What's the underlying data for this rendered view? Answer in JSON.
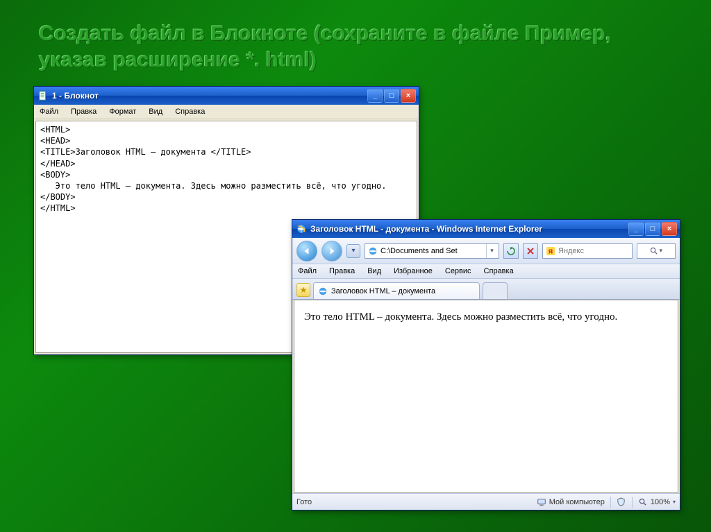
{
  "slide": {
    "title": "Создать файл в Блокноте (сохраните в файле Пример,  указав расширение  *. html)"
  },
  "notepad": {
    "title": "1 - Блокнот",
    "menu": {
      "file": "Файл",
      "edit": "Правка",
      "format": "Формат",
      "view": "Вид",
      "help": "Справка"
    },
    "code": "<HTML>\n<HEAD>\n<TITLE>Заголовок HTML – документа </TITLE>\n</HEAD>\n<BODY>\n   Это тело HTML – документа. Здесь можно разместить всё, что угодно.\n</BODY>\n</HTML>"
  },
  "ie": {
    "title": "Заголовок HTML - документа - Windows Internet Explorer",
    "address": "C:\\Documents and Set",
    "search_placeholder": "Яндекс",
    "menu": {
      "file": "Файл",
      "edit": "Правка",
      "view": "Вид",
      "favorites": "Избранное",
      "tools": "Сервис",
      "help": "Справка"
    },
    "tab_label": "Заголовок HTML – документа",
    "body_text": "Это тело HTML – документа. Здесь можно разместить всё, что угодно.",
    "status": {
      "ready": "Гото",
      "zone": "Мой компьютер",
      "zoom": "100%"
    }
  },
  "winbtns": {
    "min": "_",
    "max": "□",
    "close": "×"
  }
}
